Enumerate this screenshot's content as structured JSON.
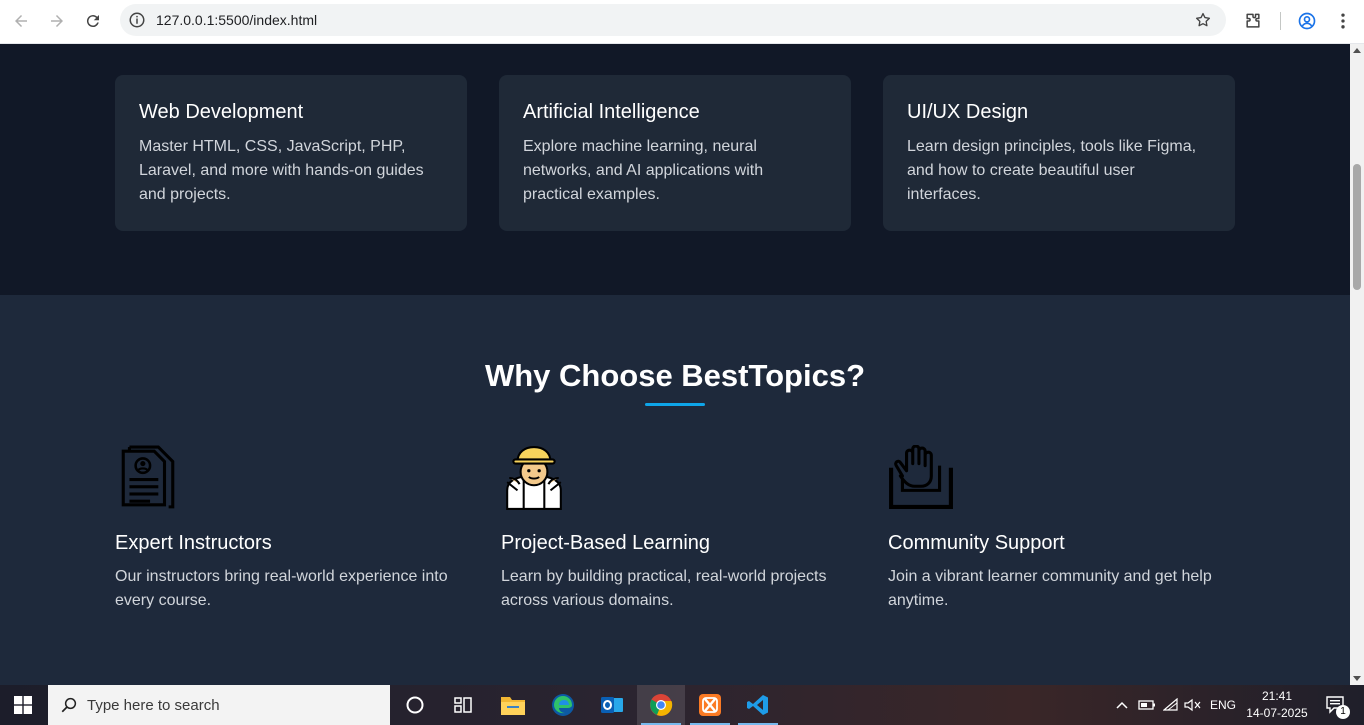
{
  "browser": {
    "url": "127.0.0.1:5500/index.html"
  },
  "topics": [
    {
      "title": "Web Development",
      "description": "Master HTML, CSS, JavaScript, PHP, Laravel, and more with hands-on guides and projects."
    },
    {
      "title": "Artificial Intelligence",
      "description": "Explore machine learning, neural networks, and AI applications with practical examples."
    },
    {
      "title": "UI/UX Design",
      "description": "Learn design principles, tools like Figma, and how to create beautiful user interfaces."
    }
  ],
  "why": {
    "title": "Why Choose BestTopics?",
    "features": [
      {
        "icon": "resume-document-icon",
        "title": "Expert Instructors",
        "description": "Our instructors bring real-world experience into every course."
      },
      {
        "icon": "worker-hardhat-icon",
        "title": "Project-Based Learning",
        "description": "Learn by building practical, real-world projects across various domains."
      },
      {
        "icon": "raised-hand-icon",
        "title": "Community Support",
        "description": "Join a vibrant learner community and get help anytime."
      }
    ]
  },
  "taskbar": {
    "search_placeholder": "Type here to search",
    "language": "ENG",
    "time": "21:41",
    "date": "14-07-2025",
    "notification_count": "1"
  },
  "colors": {
    "accent": "#0ea5e9",
    "topics_bg": "#111827",
    "card_bg": "#1f2937",
    "section_bg": "#1e293b"
  }
}
